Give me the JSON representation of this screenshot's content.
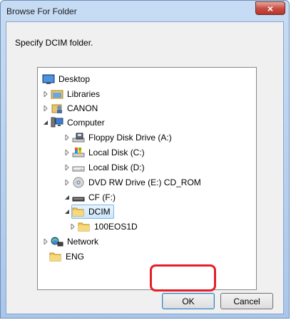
{
  "window": {
    "title": "Browse For Folder",
    "close_symbol": "×"
  },
  "dialog": {
    "description": "Specify DCIM folder."
  },
  "tree": {
    "items": [
      {
        "label": "Desktop",
        "icon": "desktop-icon"
      },
      {
        "label": "Libraries",
        "icon": "libraries-icon"
      },
      {
        "label": "CANON",
        "icon": "user-folder-icon"
      },
      {
        "label": "Computer",
        "icon": "computer-icon"
      },
      {
        "label": "Floppy Disk Drive (A:)",
        "icon": "floppy-drive-icon"
      },
      {
        "label": "Local Disk (C:)",
        "icon": "system-disk-icon"
      },
      {
        "label": "Local Disk (D:)",
        "icon": "hard-disk-icon"
      },
      {
        "label": "DVD RW Drive (E:) CD_ROM",
        "icon": "dvd-drive-icon"
      },
      {
        "label": "CF (F:)",
        "icon": "removable-drive-icon"
      },
      {
        "label": "DCIM",
        "icon": "folder-icon",
        "selected": true
      },
      {
        "label": "100EOS1D",
        "icon": "folder-icon"
      },
      {
        "label": "Network",
        "icon": "network-icon"
      },
      {
        "label": "ENG",
        "icon": "folder-icon"
      }
    ]
  },
  "buttons": {
    "ok_label": "OK",
    "cancel_label": "Cancel"
  },
  "colors": {
    "selection_border": "#7db7e6",
    "highlight_ring": "#e61e29",
    "close_button": "#c75047"
  }
}
